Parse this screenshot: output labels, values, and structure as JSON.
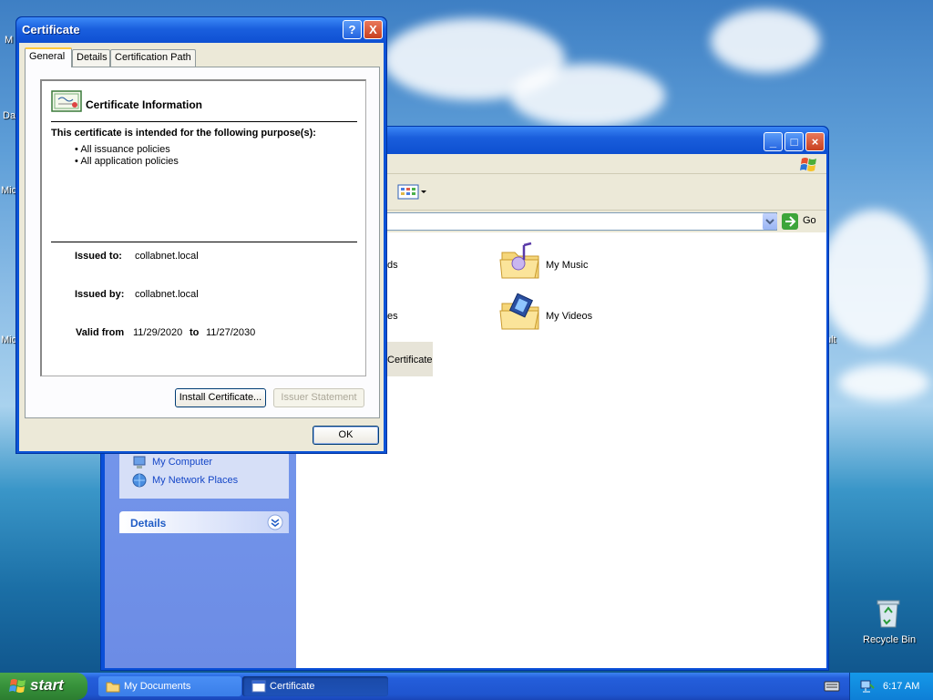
{
  "desktop": {
    "left_icons": [
      "M",
      "Da",
      "Mic",
      "Mic"
    ],
    "right_icon_fragment": "ult",
    "recycle_bin": "Recycle Bin"
  },
  "explorer": {
    "folders": [
      {
        "label": "ds"
      },
      {
        "label": "My Music"
      },
      {
        "label": "es"
      },
      {
        "label": "My Videos"
      },
      {
        "label": "Certificate"
      }
    ],
    "address_go": "Go",
    "other_places": [
      "My Computer",
      "My Network Places"
    ],
    "details_header": "Details"
  },
  "certificate": {
    "title": "Certificate",
    "tabs": [
      "General",
      "Details",
      "Certification Path"
    ],
    "info_title": "Certificate Information",
    "purpose_heading": "This certificate is intended for the following purpose(s):",
    "purposes": [
      "All issuance policies",
      "All application policies"
    ],
    "issued_to_label": "Issued to:",
    "issued_to": "collabnet.local",
    "issued_by_label": "Issued by:",
    "issued_by": "collabnet.local",
    "valid_from_label": "Valid from",
    "valid_from": "11/29/2020",
    "valid_to_label": "to",
    "valid_to": "11/27/2030",
    "install_button": "Install Certificate...",
    "issuer_statement_button": "Issuer Statement",
    "ok_button": "OK",
    "help_glyph": "?",
    "close_glyph": "X"
  },
  "taskbar": {
    "start_label": "start",
    "tasks": [
      "My Documents",
      "Certificate"
    ],
    "clock": "6:17 AM"
  }
}
